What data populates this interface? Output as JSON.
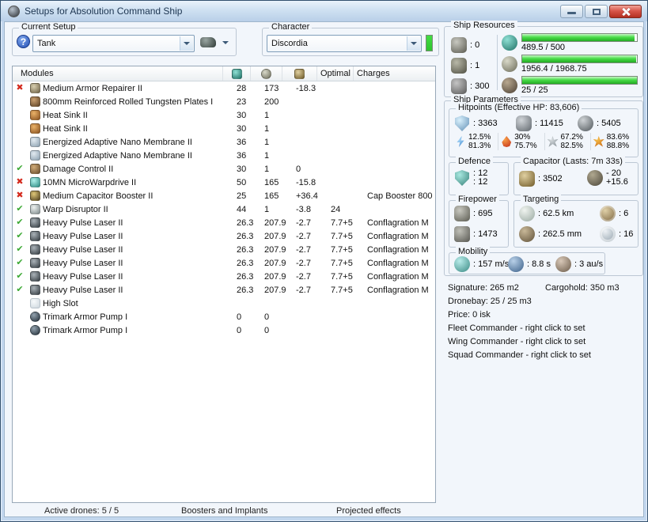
{
  "window": {
    "title": "Setups for Absolution Command Ship"
  },
  "setup": {
    "group_label": "Current Setup",
    "value": "Tank",
    "character_group_label": "Character",
    "character_value": "Discordia"
  },
  "colors": {
    "resource_bar_green": "#3fd23f",
    "character_status_green": "#44dd44",
    "status_ok": "#3aa832",
    "status_bad": "#d42b1e"
  },
  "modules_table": {
    "header_modules": "Modules",
    "header_optimal": "Optimal",
    "header_charges": "Charges",
    "header_icons": [
      "cpu-icon",
      "powergrid-icon",
      "capacitor-icon"
    ],
    "rows": [
      {
        "status": "bad",
        "type": "armor-repairer",
        "name": "Medium Armor Repairer II",
        "cpu": "28",
        "pg": "173",
        "cap": "-18.3",
        "optimal": "",
        "charges": ""
      },
      {
        "status": "",
        "type": "armor-plate",
        "name": "800mm Reinforced Rolled Tungsten Plates I",
        "cpu": "23",
        "pg": "200",
        "cap": "",
        "optimal": "",
        "charges": ""
      },
      {
        "status": "",
        "type": "heat-sink",
        "name": "Heat Sink II",
        "cpu": "30",
        "pg": "1",
        "cap": "",
        "optimal": "",
        "charges": ""
      },
      {
        "status": "",
        "type": "heat-sink",
        "name": "Heat Sink II",
        "cpu": "30",
        "pg": "1",
        "cap": "",
        "optimal": "",
        "charges": ""
      },
      {
        "status": "",
        "type": "nano-membrane",
        "name": "Energized Adaptive Nano Membrane II",
        "cpu": "36",
        "pg": "1",
        "cap": "",
        "optimal": "",
        "charges": ""
      },
      {
        "status": "",
        "type": "nano-membrane",
        "name": "Energized Adaptive Nano Membrane II",
        "cpu": "36",
        "pg": "1",
        "cap": "",
        "optimal": "",
        "charges": ""
      },
      {
        "status": "good",
        "type": "damage-control",
        "name": "Damage Control II",
        "cpu": "30",
        "pg": "1",
        "cap": "0",
        "optimal": "",
        "charges": ""
      },
      {
        "status": "bad",
        "type": "mwd",
        "name": "10MN MicroWarpdrive II",
        "cpu": "50",
        "pg": "165",
        "cap": "-15.8",
        "optimal": "",
        "charges": ""
      },
      {
        "status": "bad",
        "type": "cap-booster",
        "name": "Medium Capacitor Booster II",
        "cpu": "25",
        "pg": "165",
        "cap": "+36.4",
        "optimal": "",
        "charges": "Cap Booster 800"
      },
      {
        "status": "good",
        "type": "warp-disruptor",
        "name": "Warp Disruptor II",
        "cpu": "44",
        "pg": "1",
        "cap": "-3.8",
        "optimal": "24",
        "charges": ""
      },
      {
        "status": "good",
        "type": "pulse-laser",
        "name": "Heavy Pulse Laser II",
        "cpu": "26.3",
        "pg": "207.9",
        "cap": "-2.7",
        "optimal": "7.7+5",
        "charges": "Conflagration M"
      },
      {
        "status": "good",
        "type": "pulse-laser",
        "name": "Heavy Pulse Laser II",
        "cpu": "26.3",
        "pg": "207.9",
        "cap": "-2.7",
        "optimal": "7.7+5",
        "charges": "Conflagration M"
      },
      {
        "status": "good",
        "type": "pulse-laser",
        "name": "Heavy Pulse Laser II",
        "cpu": "26.3",
        "pg": "207.9",
        "cap": "-2.7",
        "optimal": "7.7+5",
        "charges": "Conflagration M"
      },
      {
        "status": "good",
        "type": "pulse-laser",
        "name": "Heavy Pulse Laser II",
        "cpu": "26.3",
        "pg": "207.9",
        "cap": "-2.7",
        "optimal": "7.7+5",
        "charges": "Conflagration M"
      },
      {
        "status": "good",
        "type": "pulse-laser",
        "name": "Heavy Pulse Laser II",
        "cpu": "26.3",
        "pg": "207.9",
        "cap": "-2.7",
        "optimal": "7.7+5",
        "charges": "Conflagration M"
      },
      {
        "status": "good",
        "type": "pulse-laser",
        "name": "Heavy Pulse Laser II",
        "cpu": "26.3",
        "pg": "207.9",
        "cap": "-2.7",
        "optimal": "7.7+5",
        "charges": "Conflagration M"
      },
      {
        "status": "",
        "type": "empty-slot",
        "name": "High Slot",
        "cpu": "",
        "pg": "",
        "cap": "",
        "optimal": "",
        "charges": ""
      },
      {
        "status": "",
        "type": "rig",
        "name": "Trimark Armor Pump I",
        "cpu": "0",
        "pg": "0",
        "cap": "",
        "optimal": "",
        "charges": ""
      },
      {
        "status": "",
        "type": "rig",
        "name": "Trimark Armor Pump I",
        "cpu": "0",
        "pg": "0",
        "cap": "",
        "optimal": "",
        "charges": ""
      }
    ]
  },
  "footer": {
    "active_drones": "Active drones: 5 / 5",
    "boosters": "Boosters and Implants",
    "projected": "Projected effects"
  },
  "ship_resources": {
    "label": "Ship Resources",
    "slots": [
      {
        "icon": "turret-hardpoints-icon",
        "value": ": 0"
      },
      {
        "icon": "launcher-hardpoints-icon",
        "value": ": 1"
      },
      {
        "icon": "calibration-icon",
        "value": ": 300"
      }
    ],
    "bars": [
      {
        "icon": "cpu-icon",
        "text": "489.5 / 500",
        "pct": 98
      },
      {
        "icon": "powergrid-icon",
        "text": "1956.4 / 1968.75",
        "pct": 99.4
      },
      {
        "icon": "drone-bandwidth-icon",
        "text": "25 / 25",
        "pct": 100
      }
    ]
  },
  "ship_parameters": {
    "label": "Ship Parameters",
    "hitpoints": {
      "label": "Hitpoints (Effective HP: 83,606)",
      "shield": ": 3363",
      "armor": ": 11415",
      "structure": ": 5405",
      "resists": [
        {
          "type": "em-resist-icon",
          "line1": "12.5%",
          "line2": "81.3%"
        },
        {
          "type": "thermal-resist-icon",
          "line1": "30%",
          "line2": "75.7%"
        },
        {
          "type": "kinetic-resist-icon",
          "line1": "67.2%",
          "line2": "82.5%"
        },
        {
          "type": "explosive-resist-icon",
          "line1": "83.6%",
          "line2": "88.8%"
        }
      ]
    },
    "defence": {
      "label": "Defence",
      "value1": ": 12",
      "value2": ": 12"
    },
    "capacitor": {
      "label": "Capacitor (Lasts: 7m 33s)",
      "amount": ": 3502",
      "peak_minus": "- 20",
      "peak_plus": "+15.6"
    },
    "firepower": {
      "label": "Firepower",
      "dps": ": 695",
      "volley": ": 1473"
    },
    "targeting": {
      "label": "Targeting",
      "range": ": 62.5 km",
      "scan_resolution": ": 262.5 mm",
      "max_targets": ": 6",
      "sensor_strength": ": 16"
    },
    "mobility": {
      "label": "Mobility",
      "speed": ": 157 m/s",
      "align_time": ": 8.8 s",
      "warp_speed": ": 3 au/s"
    }
  },
  "info": {
    "signature": "Signature: 265 m2",
    "cargohold": "Cargohold: 350 m3",
    "dronebay": "Dronebay: 25 / 25 m3",
    "price": "Price: 0 isk",
    "fleet": "Fleet Commander - right click to set",
    "wing": "Wing Commander - right click to set",
    "squad": "Squad Commander - right click to set"
  }
}
